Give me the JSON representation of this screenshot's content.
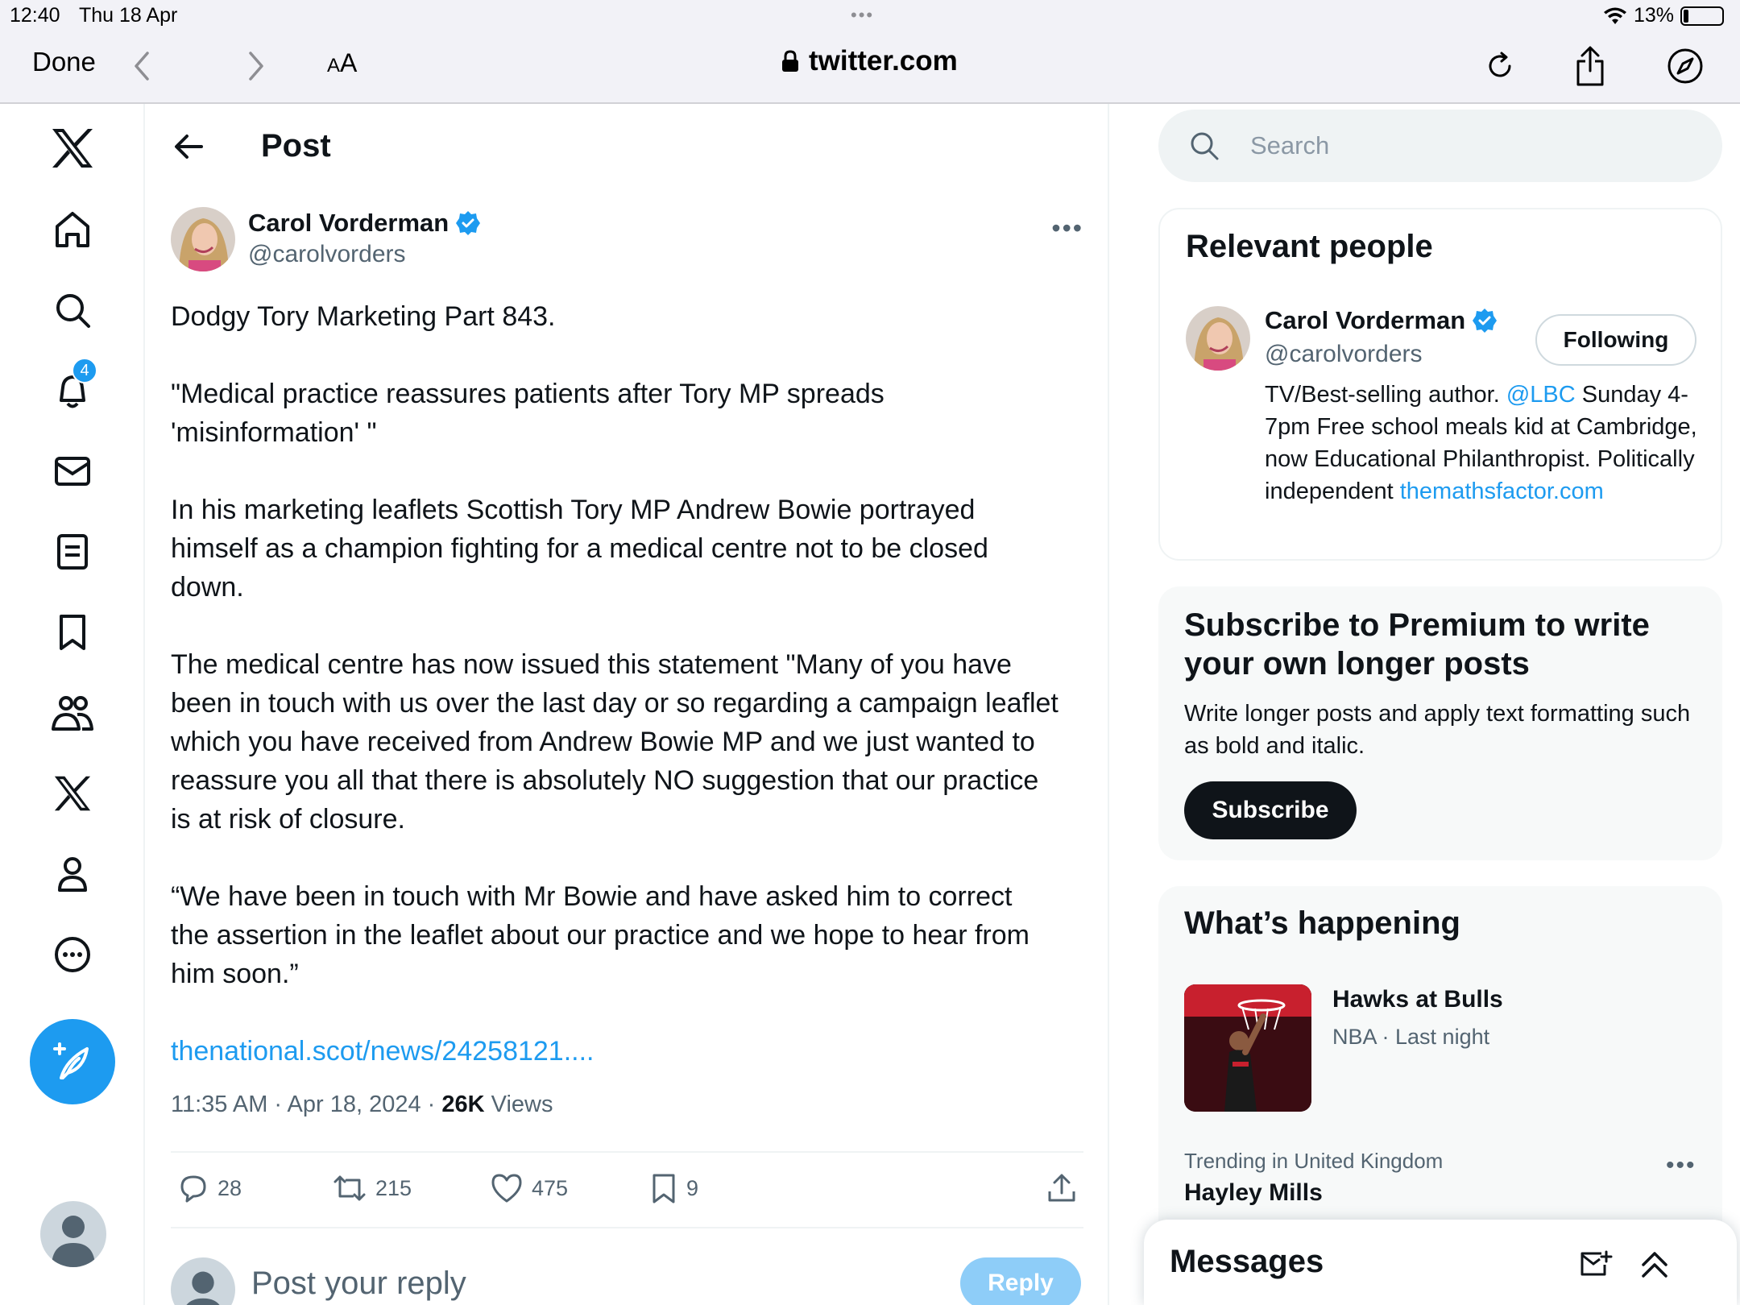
{
  "status_bar": {
    "time": "12:40",
    "date": "Thu 18 Apr",
    "battery": "13%",
    "battery_level": 0.13
  },
  "browser": {
    "done_label": "Done",
    "text_size_label_small": "A",
    "text_size_label_large": "A",
    "url": "twitter.com"
  },
  "sidebar": {
    "items": [
      {
        "name": "x-logo-icon"
      },
      {
        "name": "home-icon"
      },
      {
        "name": "explore-icon"
      },
      {
        "name": "notifications-icon",
        "badge": "4"
      },
      {
        "name": "messages-icon"
      },
      {
        "name": "lists-icon"
      },
      {
        "name": "bookmarks-icon"
      },
      {
        "name": "communities-icon"
      },
      {
        "name": "premium-x-icon"
      },
      {
        "name": "profile-icon"
      },
      {
        "name": "more-icon"
      }
    ]
  },
  "header": {
    "title": "Post"
  },
  "post": {
    "author_name": "Carol Vorderman",
    "author_handle": "@carolvorders",
    "paragraphs": [
      "Dodgy Tory Marketing Part 843.",
      "\"Medical practice reassures patients after Tory MP spreads\n'misinformation' \"",
      "In his marketing leaflets Scottish Tory MP Andrew Bowie portrayed\nhimself as a champion fighting for a medical centre not to be closed\ndown.",
      "The medical centre has now issued this statement \"Many of you have\nbeen in touch with us over the last day or so regarding a campaign leaflet\nwhich you have received from Andrew Bowie MP and we just wanted to\nreassure you all that there is absolutely NO suggestion that our practice\nis at risk of closure.",
      "“We have been in touch with Mr Bowie and have asked him to correct\nthe assertion in the leaflet about our practice and we hope to hear from\nhim soon.”"
    ],
    "link": "thenational.scot/news/24258121....",
    "timestamp": "11:35 AM · Apr 18, 2024 · ",
    "views_count": "26K",
    "views_label": " Views",
    "replies": "28",
    "reposts": "215",
    "likes": "475",
    "bookmarks": "9",
    "reply_placeholder": "Post your reply",
    "reply_button": "Reply"
  },
  "search": {
    "placeholder": "Search"
  },
  "relevant_people": {
    "title": "Relevant people",
    "name": "Carol Vorderman",
    "handle": "@carolvorders",
    "follow_label": "Following",
    "bio_1": "TV/Best-selling author. ",
    "bio_mention": "@LBC",
    "bio_2": " Sunday 4-7pm Free school meals kid at Cambridge, now Educational Philanthropist. Politically independent ",
    "bio_link": "themathsfactor.com"
  },
  "premium": {
    "title": "Subscribe to Premium to write your own longer posts",
    "description": "Write longer posts and apply text formatting such as bold and italic.",
    "button": "Subscribe"
  },
  "whats_happening": {
    "title": "What’s happening",
    "event_title": "Hawks at Bulls",
    "event_sub": "NBA · Last night",
    "trend_category": "Trending in United Kingdom",
    "trend_name": "Hayley Mills"
  },
  "messages_drawer": {
    "title": "Messages"
  },
  "colors": {
    "accent": "#1d9bf0",
    "text": "#0f1419",
    "secondary": "#536471"
  }
}
